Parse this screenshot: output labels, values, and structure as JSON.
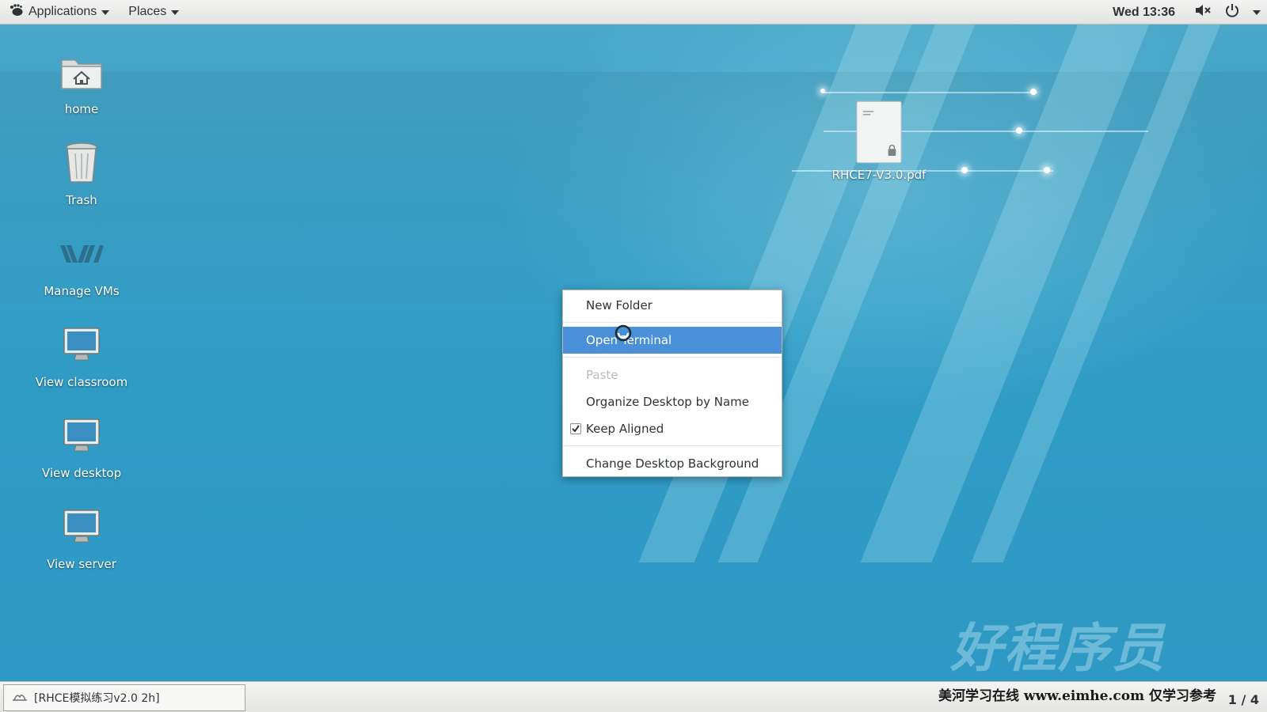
{
  "topbar": {
    "applications_label": "Applications",
    "places_label": "Places",
    "clock": "Wed 13:36",
    "icons": {
      "volume": "volume-muted-icon",
      "power": "power-icon"
    }
  },
  "desktop": {
    "icons": [
      {
        "label": "home",
        "icon": "home-folder-icon"
      },
      {
        "label": "Trash",
        "icon": "trash-icon"
      },
      {
        "label": "Manage VMs",
        "icon": "vm-logo-icon"
      },
      {
        "label": "View classroom",
        "icon": "monitor-icon"
      },
      {
        "label": "View desktop",
        "icon": "monitor-icon"
      },
      {
        "label": "View server",
        "icon": "monitor-icon"
      }
    ],
    "file": {
      "label": "RHCE7-V3.0.pdf",
      "icon": "pdf-document-icon"
    },
    "watermark": "好程序员"
  },
  "context_menu": {
    "items": [
      {
        "label": "New Folder",
        "state": "normal"
      },
      {
        "label": "Open Terminal",
        "state": "hover"
      },
      {
        "label": "Paste",
        "state": "disabled"
      },
      {
        "label": "Organize Desktop by Name",
        "state": "normal"
      },
      {
        "label": "Keep Aligned",
        "state": "checked"
      },
      {
        "label": "Change Desktop Background",
        "state": "normal"
      }
    ]
  },
  "bottombar": {
    "task_label": "[RHCE模拟练习v2.0 2h]",
    "note": "美河学习在线 www.eimhe.com 仅学习参考",
    "pager": "1 / 4"
  },
  "colors": {
    "desktop_bg": "#2f9cc4",
    "menu_highlight": "#4a90d9",
    "panel_bg": "#e8e8e7"
  }
}
